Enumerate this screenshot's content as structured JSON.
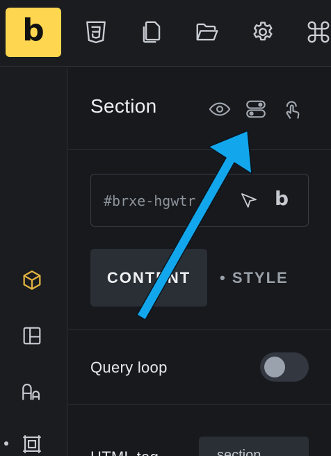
{
  "toolbar": {
    "logo_text": "b",
    "icons": [
      "css3-icon",
      "copy-pages-icon",
      "open-folder-icon",
      "settings-gear-icon",
      "command-key-icon"
    ]
  },
  "sidebar": {
    "icons": [
      "box-icon",
      "layout-icon",
      "typography-icon",
      "frame-icon"
    ],
    "active": "box-icon",
    "active_color": "#e3b341"
  },
  "panel": {
    "title": "Section",
    "header_icons": [
      "eye-icon",
      "toggle-rows-icon",
      "touch-pointer-icon"
    ],
    "element_id": "#brxe-hgwtr",
    "id_actions": [
      "pointer-arrow-icon",
      "bricks-b-icon"
    ],
    "id_b_label": "b",
    "tabs": {
      "content": "CONTENT",
      "style": "• STYLE"
    },
    "controls": {
      "query_loop_label": "Query loop",
      "query_loop_enabled": false,
      "html_tag_label": "HTML tag",
      "html_tag_value": "section"
    }
  },
  "annotation": {
    "arrow_color": "#12a7ec"
  }
}
